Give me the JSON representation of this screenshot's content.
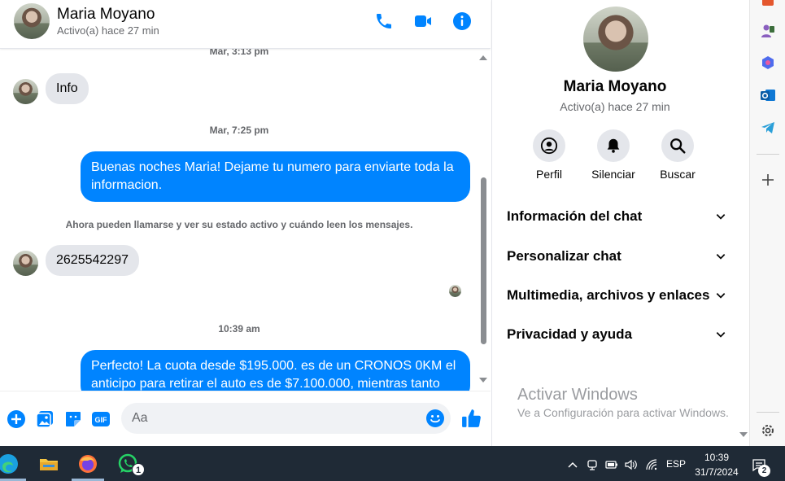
{
  "header": {
    "name": "Maria Moyano",
    "status": "Activo(a) hace 27 min"
  },
  "messages": {
    "ts1": "Mar, 3:13 pm",
    "in1": "Info",
    "ts2": "Mar, 7:25 pm",
    "out1": "Buenas noches Maria! Dejame tu numero para enviarte toda la informacion.",
    "system": "Ahora pueden llamarse y ver su estado activo y cuándo leen los mensajes.",
    "in2": "2625542297",
    "ts3": "10:39 am",
    "out2": "Perfecto! La cuota desde $195.000. es de un CRONOS 0KM el anticipo para retirar el auto es de $7.100.000, mientras tanto"
  },
  "composer": {
    "placeholder": "Aa"
  },
  "panel": {
    "name": "Maria Moyano",
    "status": "Activo(a) hace 27 min",
    "actions": [
      {
        "label": "Perfil",
        "icon": "profile-icon"
      },
      {
        "label": "Silenciar",
        "icon": "bell-icon"
      },
      {
        "label": "Buscar",
        "icon": "search-icon"
      }
    ],
    "sections": [
      {
        "label": "Información del chat"
      },
      {
        "label": "Personalizar chat"
      },
      {
        "label": "Multimedia, archivos y enlaces"
      },
      {
        "label": "Privacidad y ayuda"
      }
    ],
    "watermark_title": "Activar Windows",
    "watermark_sub": "Ve a Configuración para activar Windows."
  },
  "taskbar": {
    "whatsapp_badge": "1",
    "language": "ESP",
    "time": "10:39",
    "date": "31/7/2024",
    "notifications": "2"
  },
  "colors": {
    "messenger_blue": "#0084ff",
    "incoming_bubble": "#e4e6eb",
    "taskbar": "#1f2a36"
  }
}
